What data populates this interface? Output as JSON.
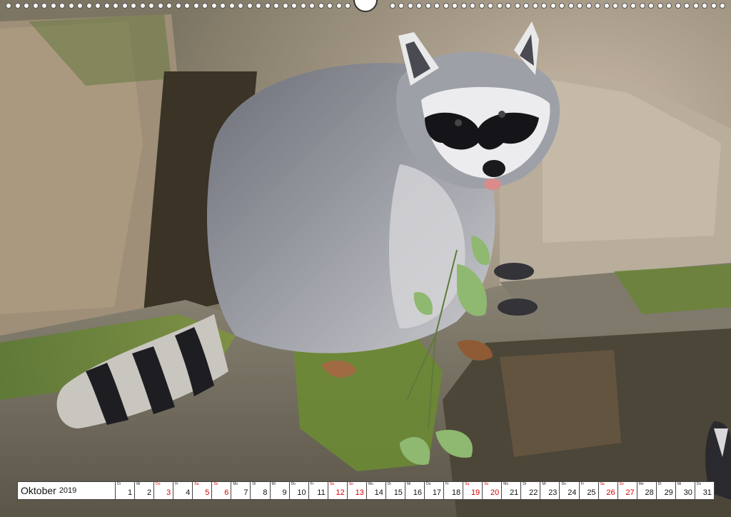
{
  "calendar": {
    "month": "Oktober",
    "year": "2019",
    "holiday_color": "#dd0000",
    "days": [
      {
        "wd": "Di",
        "num": "1",
        "red": false
      },
      {
        "wd": "Mi",
        "num": "2",
        "red": false
      },
      {
        "wd": "Do",
        "num": "3",
        "red": true
      },
      {
        "wd": "Fr",
        "num": "4",
        "red": false
      },
      {
        "wd": "Sa",
        "num": "5",
        "red": true
      },
      {
        "wd": "So",
        "num": "6",
        "red": true
      },
      {
        "wd": "Mo",
        "num": "7",
        "red": false
      },
      {
        "wd": "Di",
        "num": "8",
        "red": false
      },
      {
        "wd": "Mi",
        "num": "9",
        "red": false
      },
      {
        "wd": "Do",
        "num": "10",
        "red": false
      },
      {
        "wd": "Fr",
        "num": "11",
        "red": false
      },
      {
        "wd": "Sa",
        "num": "12",
        "red": true
      },
      {
        "wd": "So",
        "num": "13",
        "red": true
      },
      {
        "wd": "Mo",
        "num": "14",
        "red": false
      },
      {
        "wd": "Di",
        "num": "15",
        "red": false
      },
      {
        "wd": "Mi",
        "num": "16",
        "red": false
      },
      {
        "wd": "Do",
        "num": "17",
        "red": false
      },
      {
        "wd": "Fr",
        "num": "18",
        "red": false
      },
      {
        "wd": "Sa",
        "num": "19",
        "red": true
      },
      {
        "wd": "So",
        "num": "20",
        "red": true
      },
      {
        "wd": "Mo",
        "num": "21",
        "red": false
      },
      {
        "wd": "Di",
        "num": "22",
        "red": false
      },
      {
        "wd": "Mi",
        "num": "23",
        "red": false
      },
      {
        "wd": "Do",
        "num": "24",
        "red": false
      },
      {
        "wd": "Fr",
        "num": "25",
        "red": false
      },
      {
        "wd": "Sa",
        "num": "26",
        "red": true
      },
      {
        "wd": "So",
        "num": "27",
        "red": true
      },
      {
        "wd": "Mo",
        "num": "28",
        "red": false
      },
      {
        "wd": "Di",
        "num": "29",
        "red": false
      },
      {
        "wd": "Mi",
        "num": "30",
        "red": false
      },
      {
        "wd": "Do",
        "num": "31",
        "red": false
      }
    ]
  }
}
